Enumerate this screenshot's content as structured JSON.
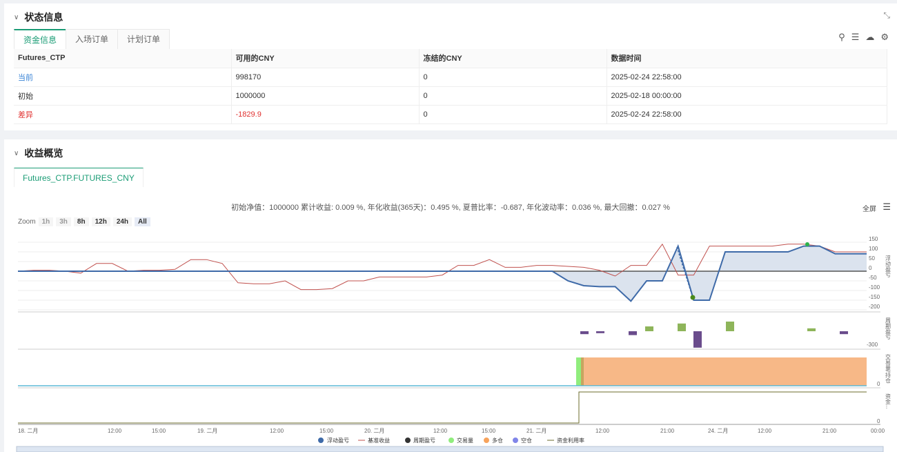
{
  "status": {
    "title": "状态信息",
    "tabs": [
      "资金信息",
      "入场订单",
      "计划订单"
    ],
    "columns": [
      "Futures_CTP",
      "可用的CNY",
      "冻结的CNY",
      "数据时间"
    ],
    "rows": [
      [
        "当前",
        "998170",
        "0",
        "2025-02-24 22:58:00"
      ],
      [
        "初始",
        "1000000",
        "0",
        "2025-02-18 00:00:00"
      ],
      [
        "差异",
        "-1829.9",
        "0",
        "2025-02-24 22:58:00"
      ]
    ]
  },
  "profit": {
    "title": "收益概览",
    "tab": "Futures_CTP.FUTURES_CNY",
    "summary": "初始净值：1000000 累计收益: 0.009 %, 年化收益(365天)：0.495 %, 夏普比率：-0.687, 年化波动率：0.036 %, 最大回撤：0.027 %",
    "fullscreen": "全屏",
    "zoom_label": "Zoom",
    "zoom_options": [
      "1h",
      "3h",
      "8h",
      "12h",
      "24h",
      "All"
    ],
    "axis_titles": [
      "浮动盈亏",
      "周期盈亏",
      "交易量/持仓",
      "资金..."
    ],
    "y_ticks_1": [
      "150",
      "100",
      "50",
      "0",
      "-50",
      "-100",
      "-150",
      "-200"
    ],
    "y_tick_2": "-300",
    "y_tick_3": "0",
    "y_tick_4": "0",
    "x_ticks": [
      "18. 二月",
      "12:00",
      "15:00",
      "19. 二月",
      "12:00",
      "15:00",
      "20. 二月",
      "12:00",
      "15:00",
      "21. 二月",
      "12:00",
      "21:00",
      "24. 二月",
      "12:00",
      "21:00",
      "00:00"
    ],
    "legend": [
      "浮动盈亏",
      "基准收益",
      "周期盈亏",
      "交易量",
      "多仓",
      "空仓",
      "资金利用率"
    ],
    "colors": {
      "float": "#3e6aa8",
      "bench": "#c0504d",
      "cycle": "#333333",
      "volume": "#90ed7d",
      "long": "#f7a35c",
      "short": "#8085e9",
      "usage": "#6b6b2b"
    }
  },
  "chart_data": {
    "type": "line",
    "series": [
      {
        "name": "浮动盈亏",
        "values": [
          0,
          0,
          0,
          0,
          0,
          0,
          0,
          0,
          0,
          0,
          0,
          0,
          0,
          0,
          0,
          0,
          0,
          0,
          0,
          0,
          0,
          0,
          0,
          0,
          0,
          0,
          0,
          0,
          0,
          0,
          0,
          0,
          0,
          0,
          0,
          -50,
          -75,
          -80,
          -80,
          -155,
          -50,
          -50,
          130,
          -150,
          -150,
          100,
          100,
          100,
          100,
          100,
          130,
          130,
          90,
          90,
          90
        ]
      },
      {
        "name": "基准收益",
        "values": [
          0,
          5,
          5,
          0,
          -10,
          40,
          40,
          0,
          5,
          5,
          10,
          60,
          60,
          40,
          -60,
          -65,
          -65,
          -50,
          -95,
          -95,
          -90,
          -50,
          -50,
          -30,
          -30,
          -30,
          -30,
          -20,
          30,
          30,
          60,
          20,
          20,
          30,
          30,
          25,
          20,
          5,
          -25,
          30,
          30,
          140,
          -20,
          -20,
          130,
          130,
          130,
          130,
          130,
          140,
          140,
          130,
          100,
          100,
          100
        ]
      },
      {
        "name": "周期盈亏",
        "values": [
          -30,
          -20,
          -40,
          50,
          80,
          -170,
          100,
          30,
          -30
        ]
      },
      {
        "name": "交易量",
        "values": [
          100
        ]
      },
      {
        "name": "多仓",
        "values": [
          100
        ]
      }
    ]
  }
}
